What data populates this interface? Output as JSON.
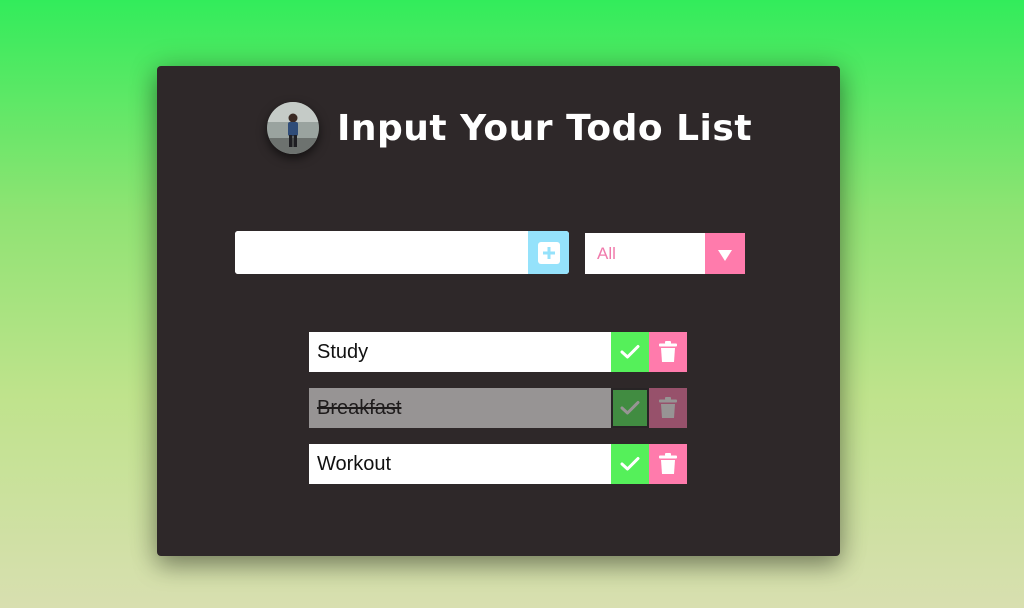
{
  "header": {
    "title": "Input Your Todo List"
  },
  "add_form": {
    "input_value": "",
    "placeholder": "",
    "button_icon": "plus-square-icon",
    "button_color": "#95e2fb"
  },
  "filter": {
    "selected": "All",
    "arrow_color": "#ff7bac"
  },
  "todos": [
    {
      "text": "Study",
      "completed": false
    },
    {
      "text": "Breakfast",
      "completed": true
    },
    {
      "text": "Workout",
      "completed": false
    }
  ],
  "colors": {
    "card_bg": "#2e2829",
    "complete": "#55f05a",
    "trash": "#ff7bac"
  }
}
